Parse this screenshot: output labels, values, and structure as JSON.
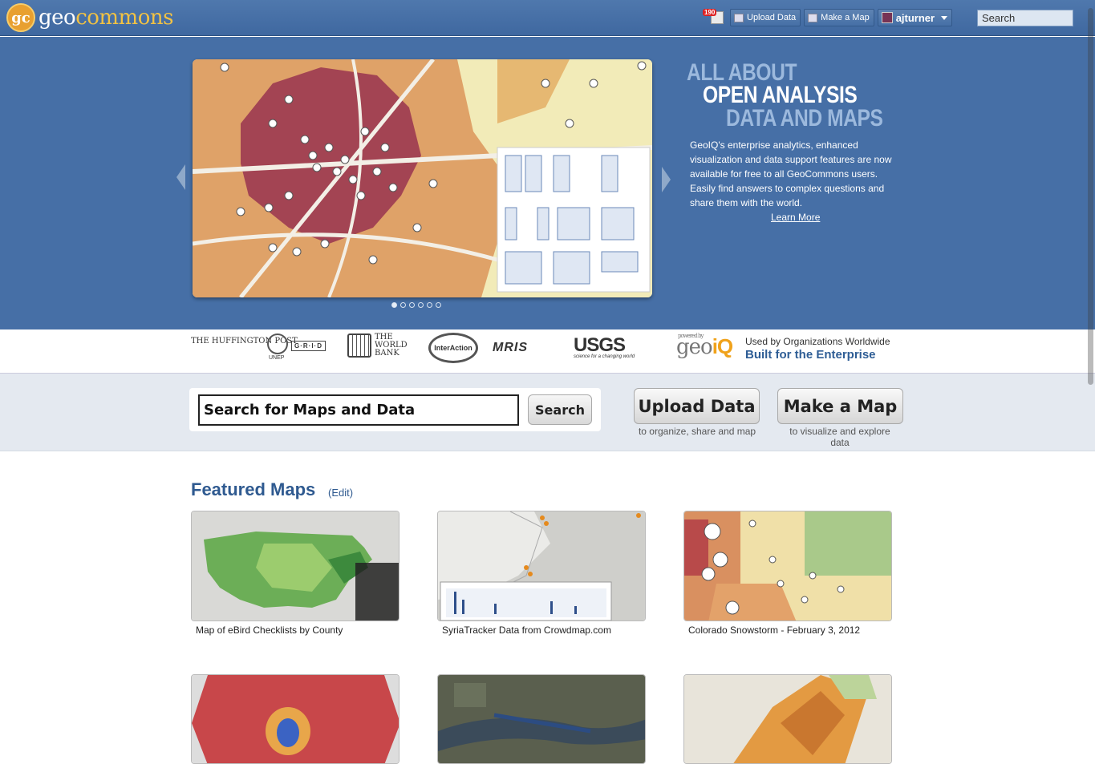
{
  "header": {
    "logo_mark": "gc",
    "logo_geo": "geo",
    "logo_commons": "commons",
    "notification_count": "190",
    "upload_label": "Upload Data",
    "make_map_label": "Make a Map",
    "username": "ajturner",
    "search_value": "Search"
  },
  "hero": {
    "line1": "ALL ABOUT",
    "line2": "OPEN ANALYSIS",
    "line3": "DATA AND MAPS",
    "description": "GeoIQ's enterprise analytics, enhanced visualization and data support features are now available for free to all GeoCommons users. Easily find answers to complex questions and share them with the world.",
    "learn_more": "Learn More",
    "slide_count": 6,
    "active_slide": 1
  },
  "partners": {
    "huffington": "THE HUFFINGTON POST",
    "unep": "UNEP",
    "grid": "G·R·I·D",
    "worldbank": "THE WORLD BANK",
    "interaction": "InterAction",
    "mris": "MRIS",
    "usgs": "USGS",
    "usgs_tag": "science for a changing world",
    "powered_by": "powered by",
    "geoiq_geo": "geo",
    "geoiq_iq": "iQ",
    "used_by": "Used by Organizations Worldwide",
    "enterprise": "Built for the Enterprise"
  },
  "search": {
    "value": "Search for Maps and Data",
    "button": "Search"
  },
  "actions": {
    "upload_title": "Upload Data",
    "upload_sub": "to organize, share and map",
    "make_title": "Make a Map",
    "make_sub": "to visualize and explore data"
  },
  "featured": {
    "title": "Featured Maps",
    "edit": "(Edit)",
    "maps": [
      {
        "caption": "Map of eBird Checklists by County"
      },
      {
        "caption": "SyriaTracker Data from Crowdmap.com"
      },
      {
        "caption": "Colorado Snowstorm - February 3, 2012"
      }
    ]
  },
  "colors": {
    "header_blue": "#466fa6",
    "link_blue": "#2f5a90",
    "accent_orange": "#f0a21b"
  }
}
